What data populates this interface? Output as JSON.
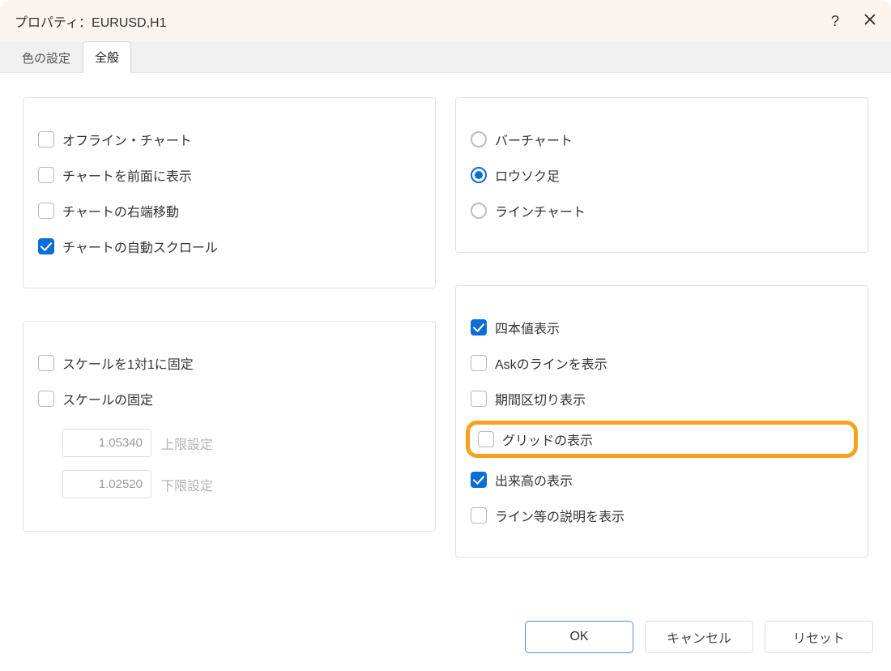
{
  "title": "プロパティ：EURUSD,H1",
  "tabs": {
    "colors": "色の設定",
    "general": "全般"
  },
  "left_panel1": {
    "offline_chart": "オフライン・チャート",
    "chart_front": "チャートを前面に表示",
    "chart_shift": "チャートの右端移動",
    "auto_scroll": "チャートの自動スクロール"
  },
  "left_panel2": {
    "scale_1to1": "スケールを1対1に固定",
    "scale_fix": "スケールの固定",
    "upper_value": "1.05340",
    "upper_label": "上限設定",
    "lower_value": "1.02520",
    "lower_label": "下限設定"
  },
  "right_panel1": {
    "bar_chart": "バーチャート",
    "candlestick": "ロウソク足",
    "line_chart": "ラインチャート"
  },
  "right_panel2": {
    "ohlc": "四本値表示",
    "ask_line": "Askのラインを表示",
    "period_sep": "期間区切り表示",
    "grid": "グリッドの表示",
    "volume": "出来高の表示",
    "desc": "ライン等の説明を表示"
  },
  "buttons": {
    "ok": "OK",
    "cancel": "キャンセル",
    "reset": "リセット"
  }
}
